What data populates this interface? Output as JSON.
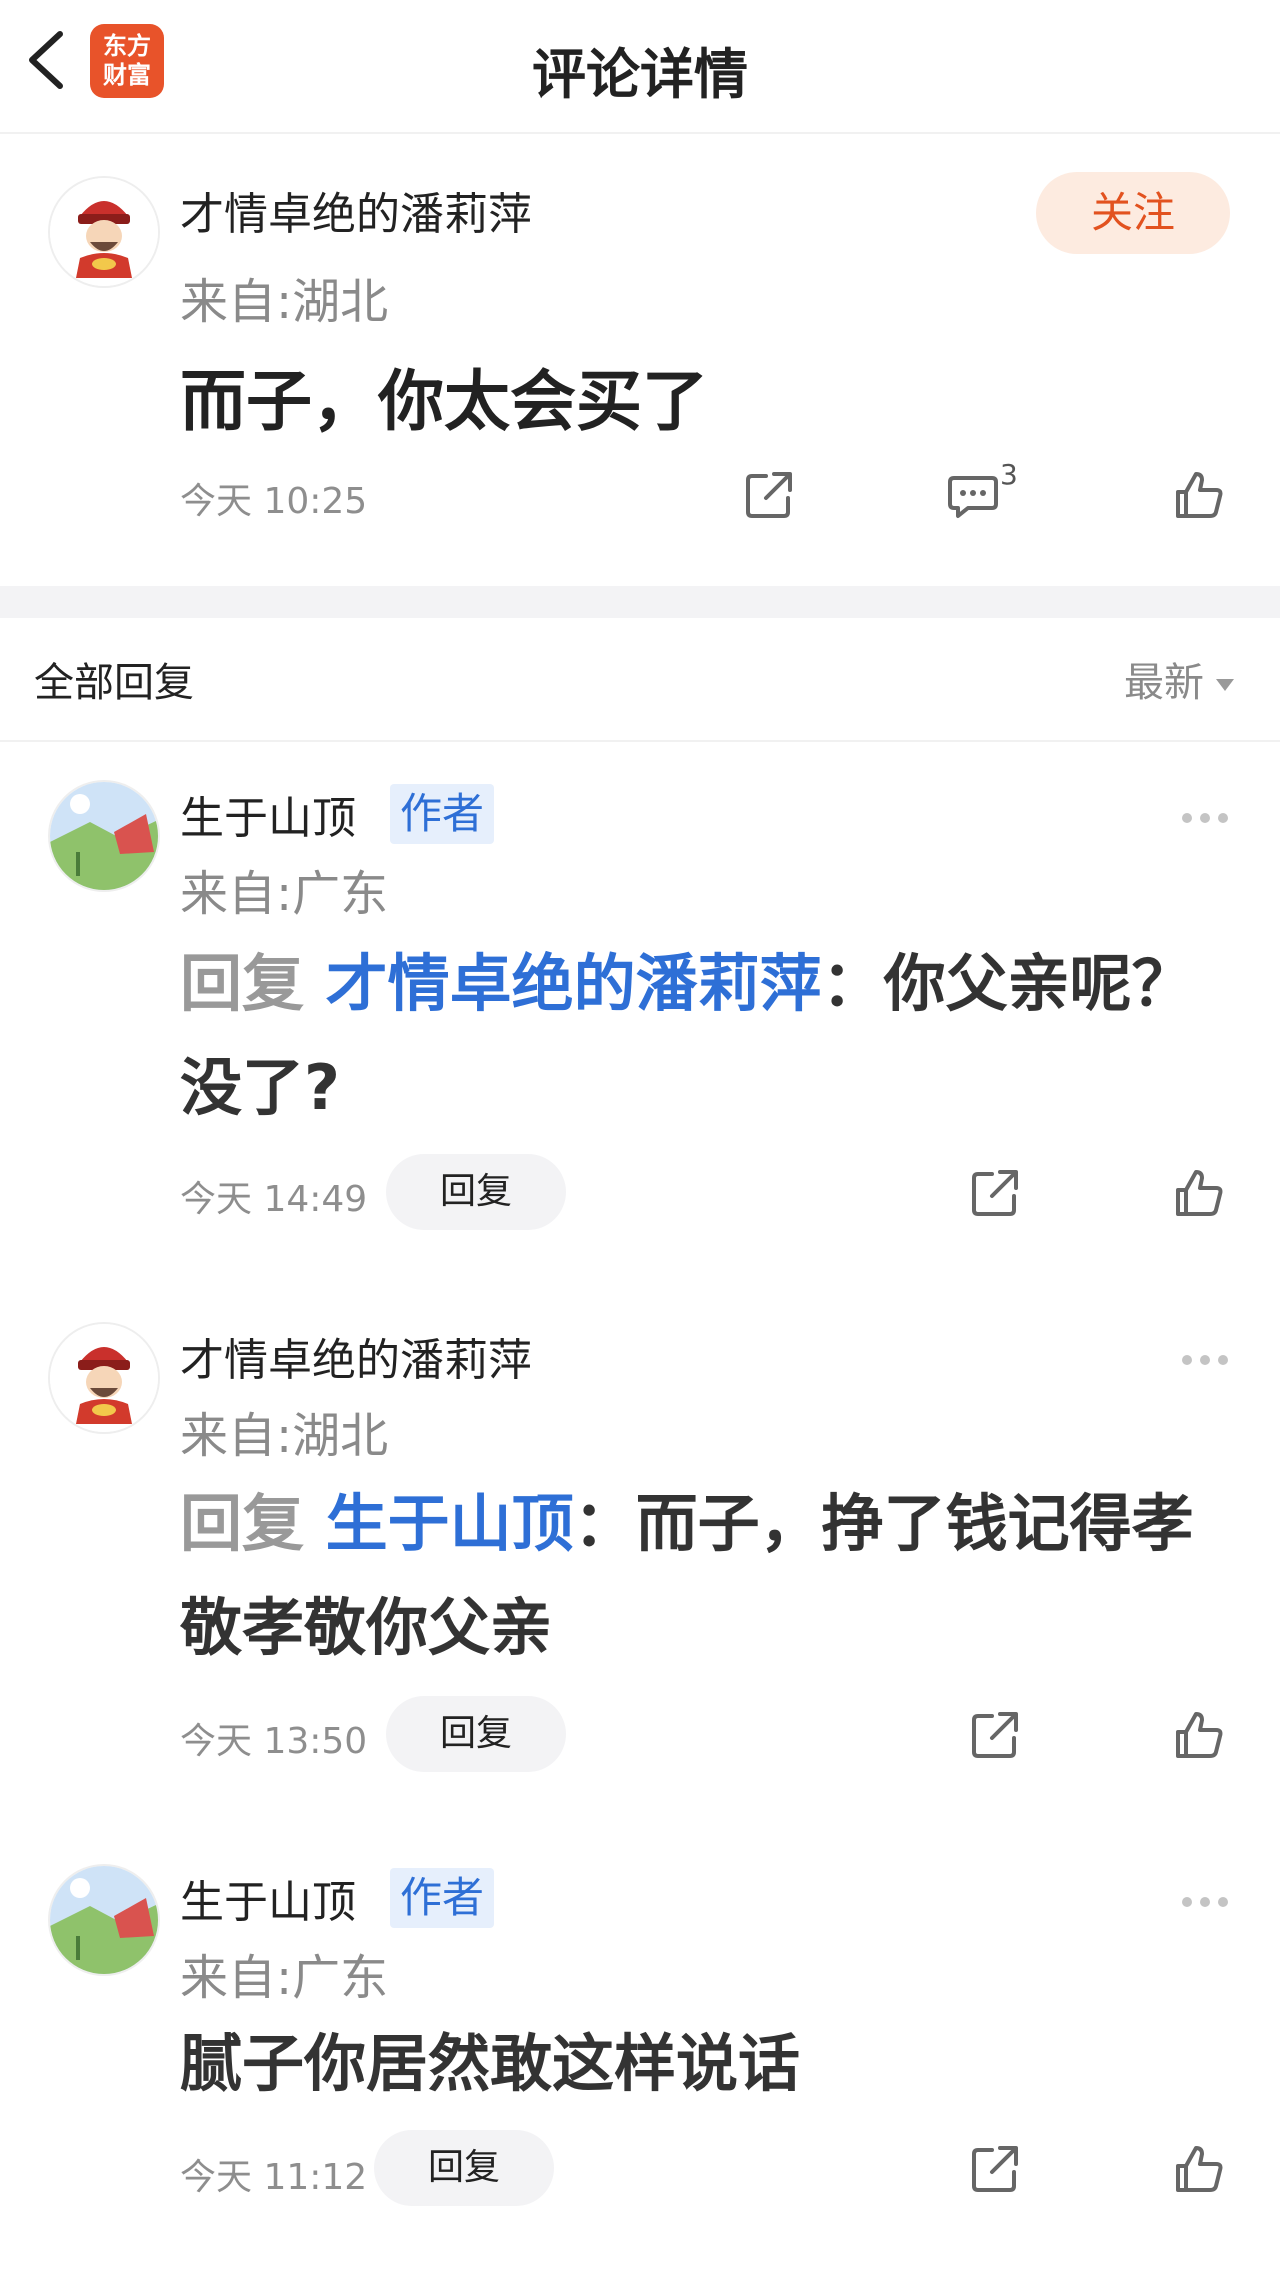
{
  "header": {
    "title": "评论详情",
    "logo_line1": "东方",
    "logo_line2": "财富"
  },
  "main_comment": {
    "author": "才情卓绝的潘莉萍",
    "location": "来自:湖北",
    "follow_label": "关注",
    "text": "而子，你太会买了",
    "time": "今天 10:25",
    "reply_count": "3"
  },
  "replies_section": {
    "title": "全部回复",
    "sort_label": "最新"
  },
  "replies": [
    {
      "author": "生于山顶",
      "tag": "作者",
      "location": "来自:广东",
      "prefix": "回复",
      "target": "才情卓绝的潘莉萍",
      "text": "：你父亲呢？没了?",
      "time": "今天 14:49",
      "reply_label": "回复"
    },
    {
      "author": "才情卓绝的潘莉萍",
      "tag": "",
      "location": "来自:湖北",
      "prefix": "回复",
      "target": "生于山顶",
      "text": "：而子，挣了钱记得孝敬孝敬你父亲",
      "time": "今天 13:50",
      "reply_label": "回复"
    },
    {
      "author": "生于山顶",
      "tag": "作者",
      "location": "来自:广东",
      "prefix": "",
      "target": "",
      "text": "腻子你居然敢这样说话",
      "time": "今天 11:12",
      "reply_label": "回复"
    }
  ],
  "icons": [
    "back-arrow-icon",
    "share-icon",
    "comment-icon",
    "like-icon",
    "more-icon",
    "sort-caret-icon"
  ],
  "colors": {
    "brand": "#e8532a",
    "link_blue": "#2e6fd6",
    "follow_text": "#e2521f",
    "follow_bg": "#fdebe0"
  }
}
